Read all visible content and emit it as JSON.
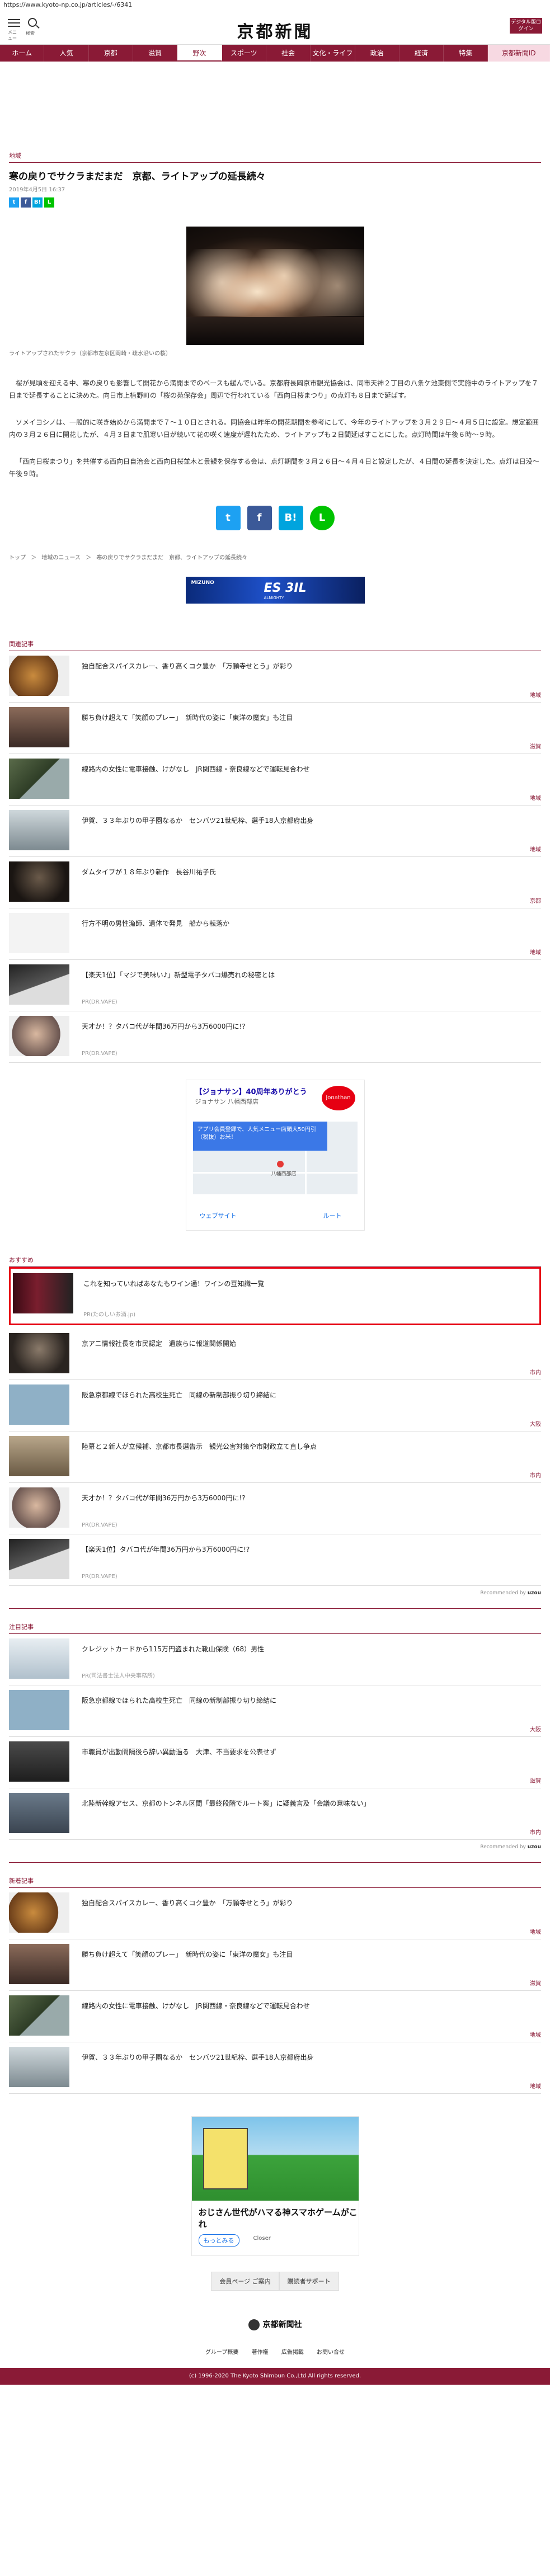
{
  "url": "https://www.kyoto-np.co.jp/articles/-/6341",
  "header": {
    "menu_label": "メニュー",
    "search_label": "検索",
    "logo": "京都新聞",
    "digital_btn": "デジタル版ログイン"
  },
  "nav": [
    "ホーム",
    "人気",
    "京都",
    "滋賀",
    "野次",
    "スポーツ",
    "社会",
    "文化・ライフ",
    "政治",
    "経済",
    "特集",
    "京都新聞ID"
  ],
  "article": {
    "section": "地域",
    "title": "寒の戻りでサクラまだまだ　京都、ライトアップの延長続々",
    "date": "2019年4月5日 16:37",
    "caption": "ライトアップされたサクラ（京都市左京区岡崎・疏水沿いの桜）",
    "paragraphs": [
      "桜が見頃を迎える中、寒の戻りも影響して開花から満開までのペースも緩んでいる。京都府長岡京市観光協会は、同市天神２丁目の八条ケ池東側で実施中のライトアップを７日まで延長することに決めた。向日市上植野町の「桜の苑保存会」周辺で行われている「西向日桜まつり」の点灯も８日まで延ばす。",
      "ソメイヨシノは、一般的に咲き始めから満開まで７〜１０日とされる。同協会は昨年の開花期間を参考にして、今年のライトアップを３月２９日〜４月５日に設定。想定範囲内の３月２６日に開花したが、４月３日まで肌寒い日が続いて花の咲く速度が遅れたため、ライトアップも２日間延ばすことにした。点灯時間は午後６時〜９時。",
      "「西向日桜まつり」を共催する西向日自治会と西向日桜並木と景観を保存する会は、点灯期間を３月２６日〜４月４日と設定したが、４日間の延長を決定した。点灯は日没〜午後９時。"
    ]
  },
  "breadcrumb": [
    "トップ",
    "＞",
    "地域のニュース",
    "＞",
    "寒の戻りでサクラまだまだ　京都、ライトアップの延長続々"
  ],
  "banner": {
    "brand": "MIZUNO",
    "name": "ES 3IL",
    "sub": "ALMIGHTY"
  },
  "related": {
    "title": "関連記事",
    "items": [
      {
        "title": "独自配合スパイスカレー、香り高くコク豊か　「万願寺せとう」が彩り",
        "tag": "地域"
      },
      {
        "title": "勝ち負け超えて「笑顔のプレー」　新時代の姿に「東洋の魔女」も注目",
        "tag": "滋賀"
      },
      {
        "title": "線路内の女性に電車接触、けがなし　JR関西線・奈良線などで運転見合わせ",
        "tag": "地域"
      },
      {
        "title": "伊賀、３３年ぶりの甲子園なるか　センバツ21世紀枠、選手18人京都府出身",
        "tag": "地域"
      },
      {
        "title": "ダムタイプが１８年ぶり新作　長谷川祐子氏",
        "tag": "京都"
      },
      {
        "title": "行方不明の男性漁師、遺体で発見　船から転落か",
        "tag": "地域"
      },
      {
        "title": "【楽天1位】「マジで美味い♪」新型電子タバコ爆売れの秘密とは",
        "pr": "PR(DR.VAPE)"
      },
      {
        "title": "天才か！？タバコ代が年間36万円から3万6000円に!?",
        "pr": "PR(DR.VAPE)"
      }
    ]
  },
  "map_ad": {
    "title": "【ジョナサン】40周年ありがとう",
    "sub": "ジョナサン 八幡西部店",
    "bubble": "アプリ会員登録で、人気メニュー店頭大50円引（税抜）お米！",
    "pin": "八幡西部店",
    "btn1": "ウェブサイト",
    "btn2": "ルート"
  },
  "recommend": {
    "title": "おすすめ",
    "items": [
      {
        "title": "これを知っていればあなたもワイン通！ワインの豆知識一覧",
        "pr": "PR(たのしいお酒.jp)"
      },
      {
        "title": "京アニ情報社長を市民認定　遺族らに報道関係開始",
        "tag": "市内"
      },
      {
        "title": "阪急京都線でほられた高校生死亡　同線の新制部振り切り締結に",
        "tag": "大阪"
      },
      {
        "title": "陸幕と２新人が立候補、京都市長選告示　観光公害対策や市財政立て直し争点",
        "tag": "市内"
      },
      {
        "title": "天才か！？タバコ代が年間36万円から3万6000円に!?",
        "pr": "PR(DR.VAPE)"
      },
      {
        "title": "【楽天1位】タバコ代が年間36万円から3万6000円に!?",
        "pr": "PR(DR.VAPE)"
      }
    ],
    "recommended_by": "Recommended by",
    "recommended_brand": "uzou"
  },
  "attention": {
    "title": "注目記事",
    "items": [
      {
        "title": "クレジットカードから115万円盗まれた靴山保険（68）男性",
        "pr": "PR(司法書士法人中央事務所)"
      },
      {
        "title": "阪急京都線でほられた高校生死亡　同線の新制部振り切り締結に",
        "tag": "大阪"
      },
      {
        "title": "市職員が出勤間隔後ら辞い異動過る　大津、不当要求を公表せず",
        "tag": "滋賀"
      },
      {
        "title": "北陸新幹線アセス、京都のトンネル区間「最終段階でルート案」に疑義言及「会議の意味ない」",
        "tag": "市内"
      }
    ],
    "recommended_by": "Recommended by",
    "recommended_brand": "uzou"
  },
  "new_articles": {
    "title": "新着記事",
    "items": [
      {
        "title": "独自配合スパイスカレー、香り高くコク豊か　「万願寺せとう」が彩り",
        "tag": "地域"
      },
      {
        "title": "勝ち負け超えて「笑顔のプレー」　新時代の姿に「東洋の魔女」も注目",
        "tag": "滋賀"
      },
      {
        "title": "線路内の女性に電車接触、けがなし　JR関西線・奈良線などで運転見合わせ",
        "tag": "地域"
      },
      {
        "title": "伊賀、３３年ぶりの甲子園なるか　センバツ21世紀枠、選手18人京都府出身",
        "tag": "地域"
      }
    ]
  },
  "game_ad": {
    "title": "おじさん世代がハマる神スマホゲームがこれ",
    "cta": "もっとみる",
    "close": "Closer"
  },
  "footer": {
    "buttons": [
      "会員ページ ご案内",
      "購読者サポート"
    ],
    "logo": "京都新聞社",
    "links": [
      "グループ概要",
      "著作権",
      "広告掲載",
      "お問い合せ"
    ],
    "copyright": "(c) 1996-2020 The Kyoto Shimbun Co.,Ltd All rights reserved."
  }
}
